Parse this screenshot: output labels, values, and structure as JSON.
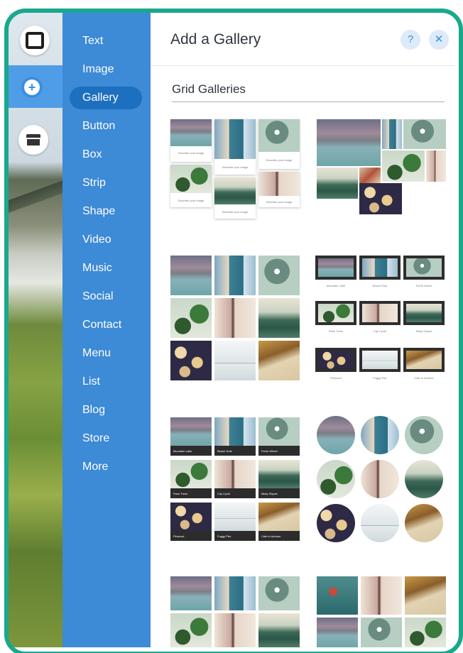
{
  "menu": {
    "items": [
      "Text",
      "Image",
      "Gallery",
      "Button",
      "Box",
      "Strip",
      "Shape",
      "Video",
      "Music",
      "Social",
      "Contact",
      "Menu",
      "List",
      "Blog",
      "Store",
      "More"
    ],
    "active": "Gallery"
  },
  "panel": {
    "title": "Add a Gallery",
    "help_label": "?",
    "close_label": "✕",
    "section_title": "Grid Galleries"
  },
  "gallery_captions": {
    "describe": "Describe your image",
    "names": [
      "Mountain Lake",
      "Beach Huts",
      "Ferris Wheel",
      "Palm Trees",
      "City Cycle",
      "Misty Slopes",
      "Pinwood",
      "Foggy Pier",
      "Cafe in Autumn"
    ]
  },
  "icons": {
    "rail": [
      "square-tool-icon",
      "add-icon",
      "store-icon"
    ]
  },
  "colors": {
    "menu_bg": "#3d8ad6",
    "menu_active": "#1d6fc0",
    "border": "#1aa88c",
    "accent": "#3b8fe0"
  }
}
